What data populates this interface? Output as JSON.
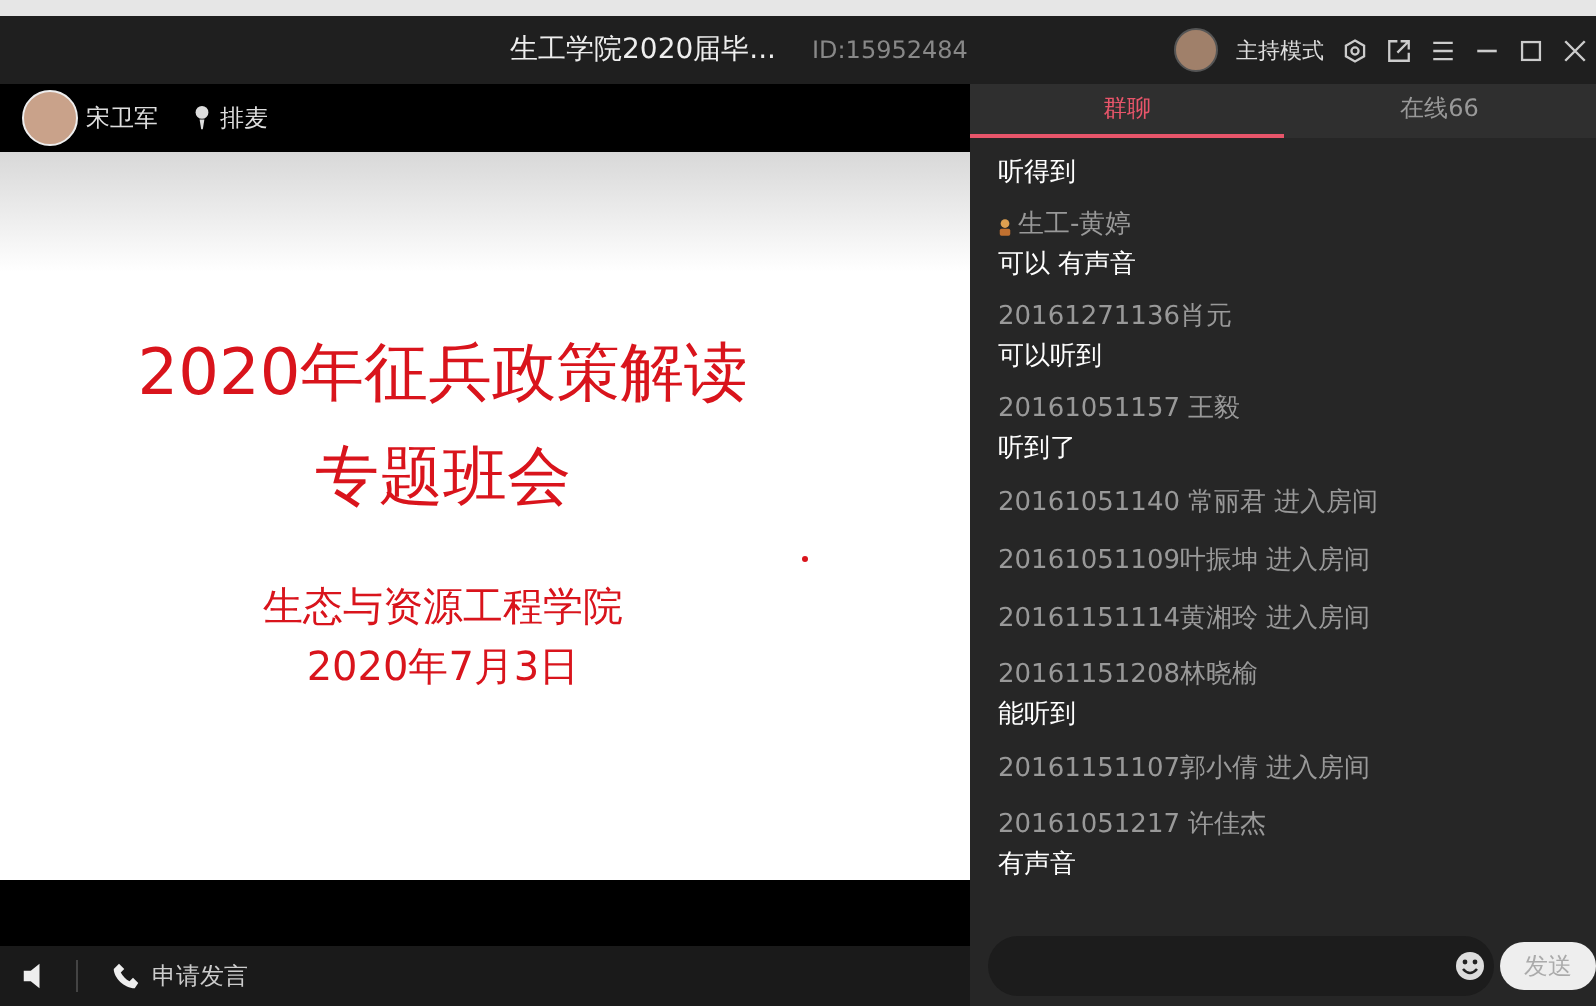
{
  "window": {
    "title": "生工学院2020届毕...",
    "room_id": "ID:15952484",
    "mode": "主持模式"
  },
  "stage": {
    "host_name": "宋卫军",
    "queue_label": "排麦",
    "slide": {
      "title_lines": [
        "2020年征兵政策解读",
        "专题班会"
      ],
      "subtitle_lines": [
        "生态与资源工程学院",
        "2020年7月3日"
      ]
    },
    "apply_label": "申请发言"
  },
  "tabs": [
    {
      "label": "群聊",
      "selected": true
    },
    {
      "label": "在线66",
      "selected": false
    }
  ],
  "messages": [
    {
      "kind": "message",
      "text": "听得到"
    },
    {
      "kind": "message",
      "name": "生工-黄婷",
      "badge": true,
      "text": "可以 有声音"
    },
    {
      "kind": "message",
      "name": "20161271136肖元",
      "badge": false,
      "text": "可以听到"
    },
    {
      "kind": "message",
      "name": "20161051157 王毅",
      "badge": false,
      "text": "听到了"
    },
    {
      "kind": "join",
      "text": "20161051140 常丽君 进入房间"
    },
    {
      "kind": "join",
      "text": "20161051109叶振坤 进入房间"
    },
    {
      "kind": "join",
      "text": "20161151114黄湘玲 进入房间"
    },
    {
      "kind": "message",
      "name": "20161151208林晓榆",
      "badge": false,
      "text": "能听到"
    },
    {
      "kind": "join",
      "text": "20161151107郭小倩 进入房间"
    },
    {
      "kind": "message",
      "name": "20161051217 许佳杰",
      "badge": false,
      "text": "有声音"
    }
  ],
  "send_button": "发送"
}
